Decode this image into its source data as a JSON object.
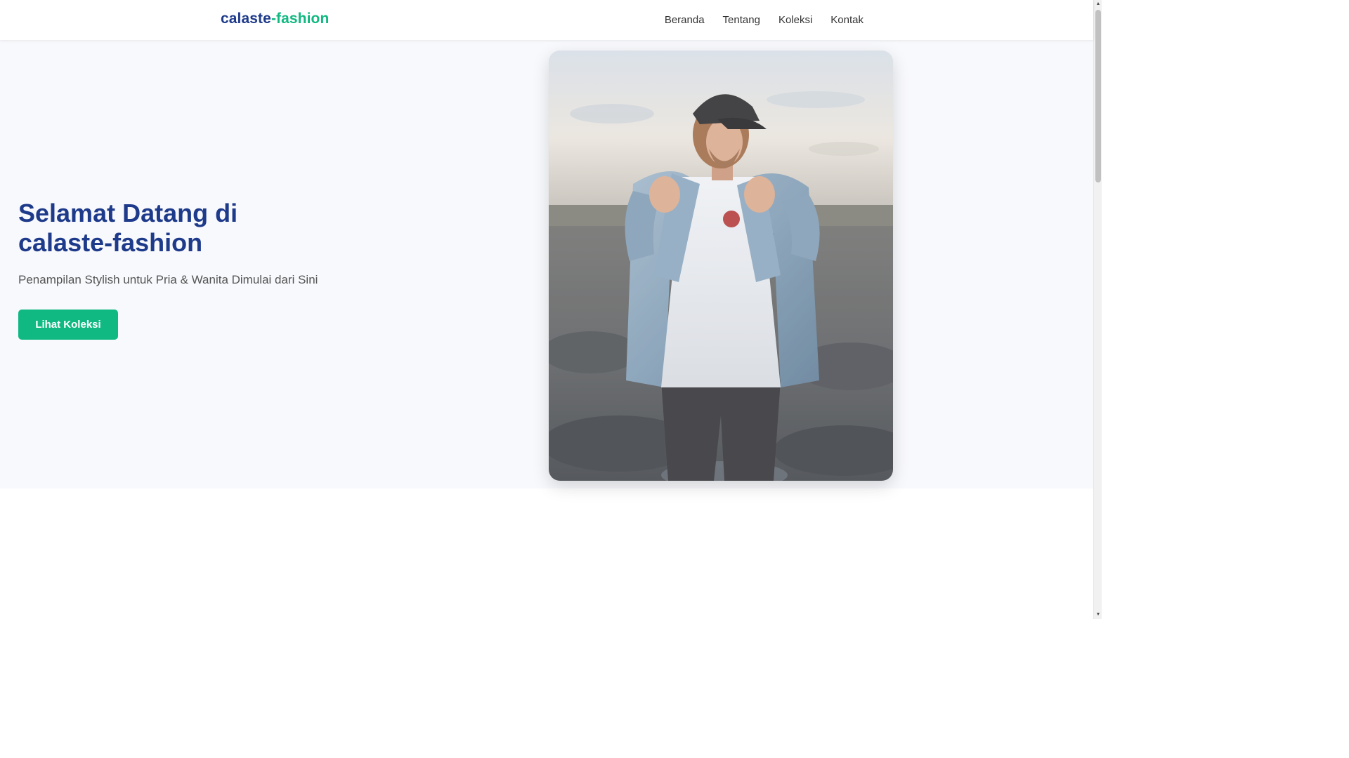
{
  "brand": {
    "name_part1": "calaste",
    "name_part2": "-fashion",
    "color_primary": "#1e3a8a",
    "color_accent": "#10b981"
  },
  "nav": {
    "items": [
      {
        "label": "Beranda"
      },
      {
        "label": "Tentang"
      },
      {
        "label": "Koleksi"
      },
      {
        "label": "Kontak"
      }
    ]
  },
  "hero": {
    "title": "Selamat Datang di calaste-fashion",
    "subtitle": "Penampilan Stylish untuk Pria & Wanita Dimulai dari Sini",
    "cta_label": "Lihat Koleksi"
  },
  "scrollbar": {
    "up_icon": "triangle-up-icon",
    "down_icon": "triangle-down-icon"
  }
}
